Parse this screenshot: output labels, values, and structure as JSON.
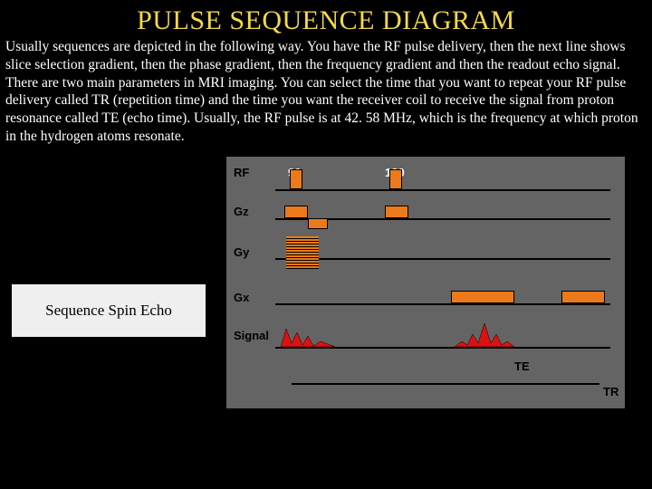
{
  "title": "PULSE SEQUENCE DIAGRAM",
  "body_text": "Usually sequences are depicted in the following way. You have the RF pulse delivery, then the next line shows slice selection gradient, then the phase gradient, then the frequency gradient and then the readout echo signal. There are two main parameters in MRI imaging. You can select the time that you want to repeat your RF pulse delivery called TR (repetition time) and the time you want the receiver coil to receive the signal from proton resonance called TE (echo time). Usually, the RF pulse is at 42. 58 MHz, which is the frequency at which proton in the hydrogen atoms resonate.",
  "caption": "Sequence Spin Echo",
  "diagram": {
    "rows": {
      "rf": "RF",
      "gz": "Gz",
      "gy": "Gy",
      "gx": "Gx",
      "signal": "Signal"
    },
    "pulses": {
      "p90": "90",
      "p180": "180"
    },
    "timing": {
      "te": "TE",
      "tr": "TR"
    }
  }
}
